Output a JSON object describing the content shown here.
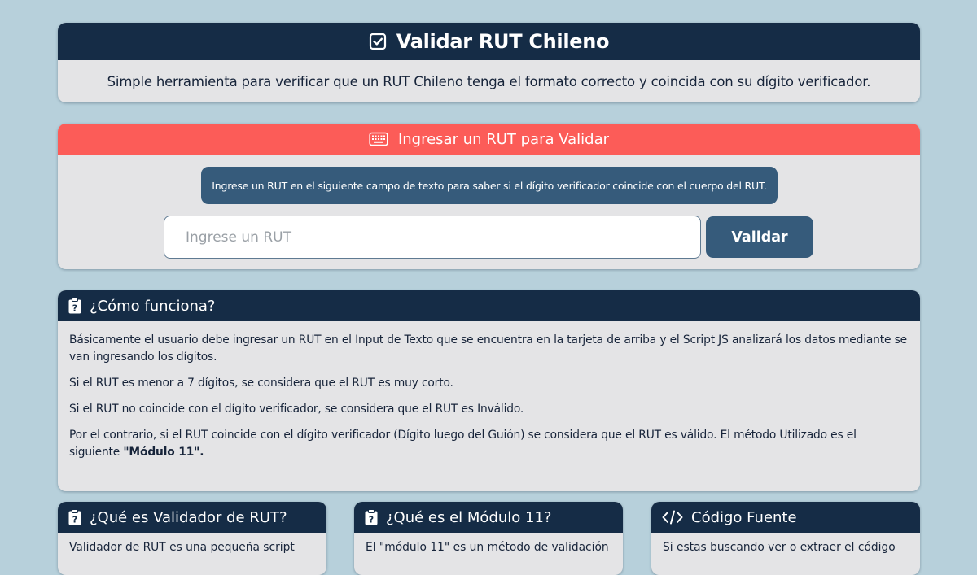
{
  "colors": {
    "page_background": "#b7d0db",
    "header_dark": "#152c46",
    "header_accent": "#fc5c58",
    "button": "#365b7b",
    "card_background": "#e4e4e6"
  },
  "title_card": {
    "icon": "check-square-icon",
    "title": "Validar RUT Chileno",
    "subtitle": "Simple herramienta para verificar que un RUT Chileno tenga el formato correcto y coincida con su dígito verificador."
  },
  "input_card": {
    "icon": "keyboard-icon",
    "header": "Ingresar un RUT para Validar",
    "info": "Ingrese un RUT en el siguiente campo de texto para saber si el dígito verificador coincide con el cuerpo del RUT.",
    "input_value": "",
    "input_placeholder": "Ingrese un RUT",
    "button_label": "Validar"
  },
  "how_card": {
    "icon": "clipboard-question-icon",
    "header": "¿Cómo funciona?",
    "paragraphs": [
      "Básicamente el usuario debe ingresar un RUT en el Input de Texto que se encuentra en la tarjeta de arriba y el Script JS analizará los datos mediante se van ingresando los dígitos.",
      "Si el RUT es menor a 7 dígitos, se considera que el RUT es muy corto.",
      "Si el RUT no coincide con el dígito verificador, se considera que el RUT es Inválido."
    ],
    "last_paragraph": "Por el contrario, si el RUT coincide con el dígito verificador (Dígito luego del Guión) se considera que el RUT es válido. El método Utilizado es el siguiente ",
    "last_paragraph_bold": "\"Módulo 11\"."
  },
  "bottom_cards": [
    {
      "icon": "clipboard-question-icon",
      "header": "¿Qué es Validador de RUT?",
      "body": "Validador de RUT es una pequeña script"
    },
    {
      "icon": "clipboard-question-icon",
      "header": "¿Qué es el Módulo 11?",
      "body": "El \"módulo 11\" es un método de validación"
    },
    {
      "icon": "code-icon",
      "header": "Código Fuente",
      "body": "Si estas buscando ver o extraer el código"
    }
  ]
}
